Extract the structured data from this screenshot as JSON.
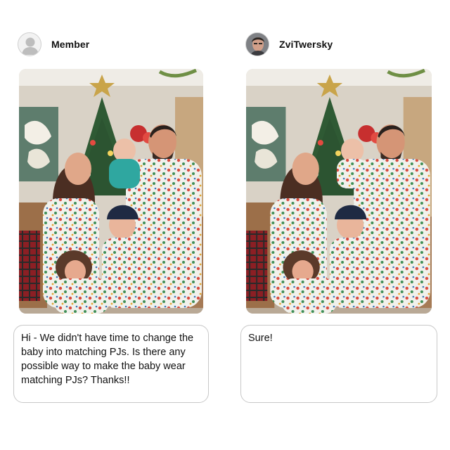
{
  "left": {
    "username": "Member",
    "message": "Hi - We didn't have time to change the baby into matching PJs. Is there any possible way to make the baby wear matching PJs? Thanks!!"
  },
  "right": {
    "username": "ZviTwersky",
    "message": "Sure!"
  },
  "colors": {
    "bubble_border": "#c8c8c8",
    "baby_shirt_original": "#2fa7a0",
    "pajama_base": "#f1f1ec"
  },
  "icons": {
    "member_avatar": "default-user-avatar",
    "zvi_avatar": "user-photo-avatar"
  }
}
